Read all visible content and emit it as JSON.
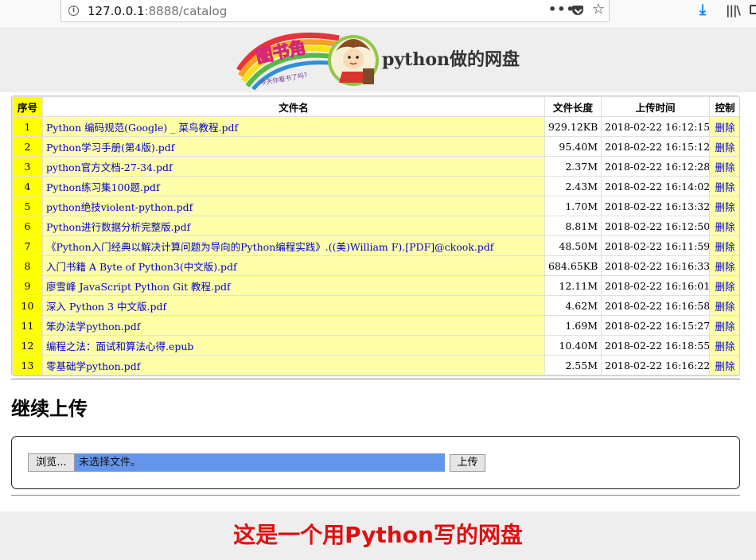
{
  "browser": {
    "url_host": "127.0.0.1",
    "url_rest": ":8888/catalog",
    "menu_dots": "•••",
    "star_glyph": "☆",
    "download_glyph": "⤓",
    "library_glyph": "|||\\"
  },
  "header": {
    "logo_text": "图书角",
    "logo_subtext": "今天你看书了吗?",
    "title": "python做的网盘"
  },
  "table": {
    "headers": [
      "序号",
      "文件名",
      "文件长度",
      "上传时间",
      "控制"
    ],
    "rows": [
      {
        "idx": "1",
        "name": "Python 编码规范(Google) _ 菜鸟教程.pdf",
        "size": "929.12KB",
        "time": "2018-02-22 16:12:15",
        "action": "删除"
      },
      {
        "idx": "2",
        "name": "Python学习手册(第4版).pdf",
        "size": "95.40M",
        "time": "2018-02-22 16:15:12",
        "action": "删除"
      },
      {
        "idx": "3",
        "name": "python官方文档-27-34.pdf",
        "size": "2.37M",
        "time": "2018-02-22 16:12:28",
        "action": "删除"
      },
      {
        "idx": "4",
        "name": "Python练习集100题.pdf",
        "size": "2.43M",
        "time": "2018-02-22 16:14:02",
        "action": "删除"
      },
      {
        "idx": "5",
        "name": "python绝技violent-python.pdf",
        "size": "1.70M",
        "time": "2018-02-22 16:13:32",
        "action": "删除"
      },
      {
        "idx": "6",
        "name": "Python进行数据分析完整版.pdf",
        "size": "8.81M",
        "time": "2018-02-22 16:12:50",
        "action": "删除"
      },
      {
        "idx": "7",
        "name": "《Python入门经典以解决计算问题为导向的Python编程实践》.((美)William F).[PDF]@ckook.pdf",
        "size": "48.50M",
        "time": "2018-02-22 16:11:59",
        "action": "删除"
      },
      {
        "idx": "8",
        "name": "入门书籍 A Byte of Python3(中文版).pdf",
        "size": "684.65KB",
        "time": "2018-02-22 16:16:33",
        "action": "删除"
      },
      {
        "idx": "9",
        "name": "廖雪峰 JavaScript Python Git 教程.pdf",
        "size": "12.11M",
        "time": "2018-02-22 16:16:01",
        "action": "删除"
      },
      {
        "idx": "10",
        "name": "深入 Python 3 中文版.pdf",
        "size": "4.62M",
        "time": "2018-02-22 16:16:58",
        "action": "删除"
      },
      {
        "idx": "11",
        "name": "笨办法学python.pdf",
        "size": "1.69M",
        "time": "2018-02-22 16:15:27",
        "action": "删除"
      },
      {
        "idx": "12",
        "name": "编程之法：面试和算法心得.epub",
        "size": "10.40M",
        "time": "2018-02-22 16:18:55",
        "action": "删除"
      },
      {
        "idx": "13",
        "name": "零基础学python.pdf",
        "size": "2.55M",
        "time": "2018-02-22 16:16:22",
        "action": "删除"
      }
    ]
  },
  "upload": {
    "heading": "继续上传",
    "browse_label": "浏览...",
    "file_status": "未选择文件。",
    "submit_label": "上传"
  },
  "footer": {
    "text": "这是一个用Python写的网盘"
  },
  "colors": {
    "index_bg": "#ffff00",
    "name_bg": "#ffffaa",
    "link": "#0000cc",
    "file_input_bg": "#6495ed",
    "footer_text": "#dd1111"
  }
}
